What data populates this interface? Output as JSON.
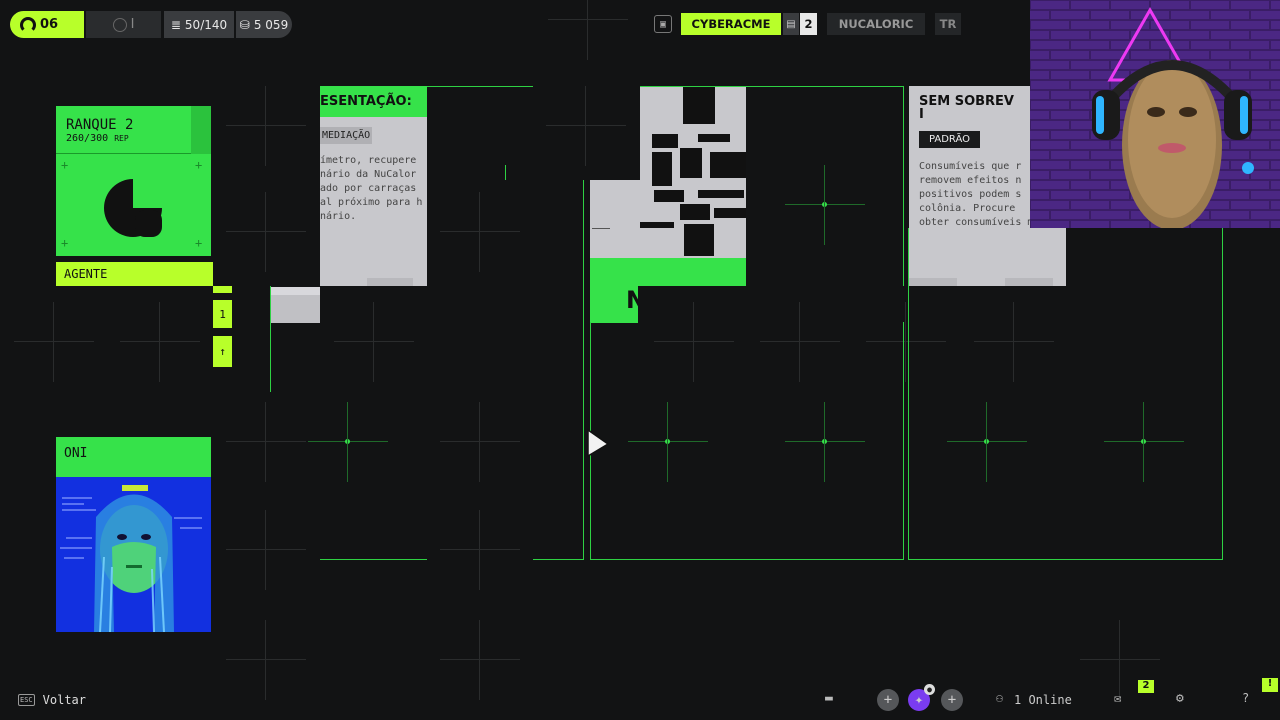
{
  "topbar": {
    "level": "06",
    "faction_mark": "I",
    "missions": "50/140",
    "credits": "5 059"
  },
  "tabs": {
    "active": "CYBERACME",
    "doc_count": "2",
    "second": "NUCALORIC",
    "third": "TR"
  },
  "rank_card": {
    "title": "RANQUE 2",
    "rep": "260/300",
    "rep_unit": "REP",
    "role": "AGENTE",
    "side_value": "1",
    "up_arrow": "↑"
  },
  "operator": {
    "name": "ONI"
  },
  "panel_left": {
    "title": "ESENTAÇÃO:",
    "chip": "MEDIAÇÃO",
    "lines": [
      "ímetro, recupere",
      "nário da NuCalor",
      "ado por carraças",
      "al próximo para h",
      "nário."
    ]
  },
  "panel_right": {
    "title_line1": "SEM SOBREV",
    "title_line2": "I",
    "chip": "PADRÃO",
    "lines": [
      "Consumíveis que r",
      "removem efeitos n",
      "positivos podem s",
      "colônia. Procure",
      "obter consumíveis melho"
    ]
  },
  "center_fragment": "N",
  "bottom": {
    "back_key": "ESC",
    "back_label": "Voltar",
    "online": "1 Online",
    "mail_badge": "2",
    "alert_badge": "!",
    "help": "?"
  },
  "colors": {
    "accent_lime": "#b8ff2a",
    "accent_green": "#36e24a",
    "background": "#121314"
  }
}
